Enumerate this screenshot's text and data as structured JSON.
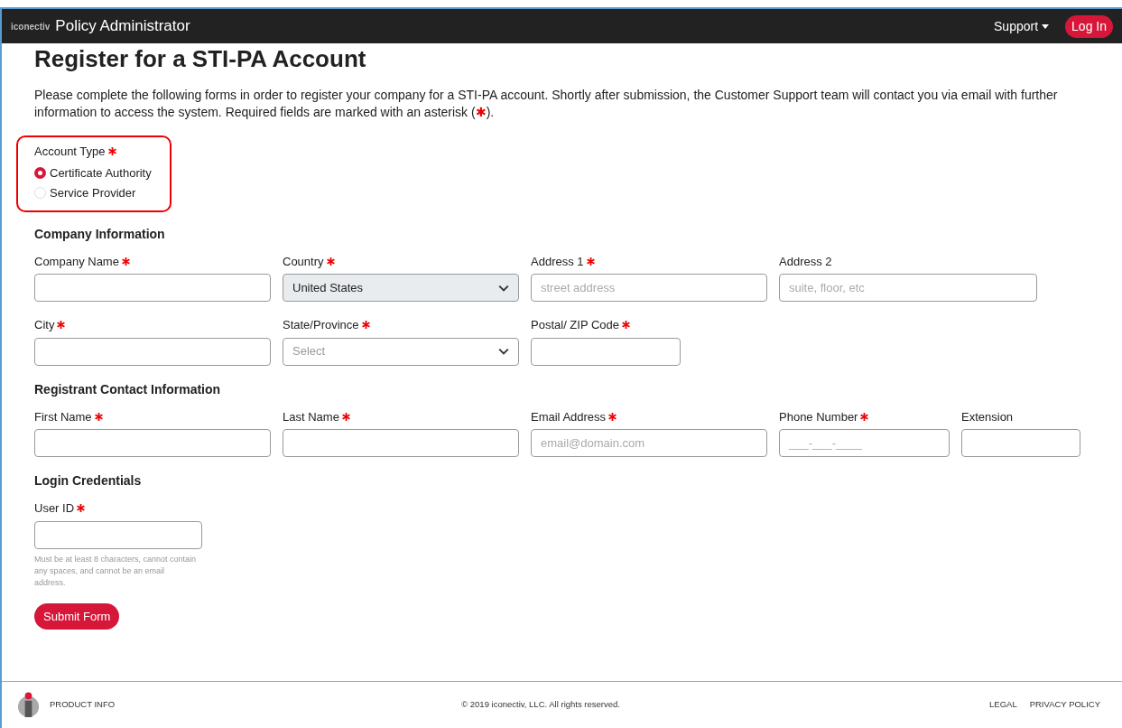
{
  "navbar": {
    "brand": "iconectiv",
    "title": "Policy Administrator",
    "support": "Support",
    "login": "Log In"
  },
  "page_title": "Register for a STI-PA Account",
  "intro": {
    "text": "Please complete the following forms in order to register your company for a STI-PA account. Shortly after submission, the Customer Support team will contact you via email with further information to access the system. Required fields are marked with an asterisk (",
    "mark": "✱",
    "end": ")."
  },
  "account_type": {
    "label": "Account Type",
    "required": true,
    "highlighted": true,
    "options": [
      {
        "label": "Certificate Authority",
        "selected": true
      },
      {
        "label": "Service Provider",
        "selected": false
      }
    ]
  },
  "sections": [
    {
      "title": "Company Information",
      "rows": [
        [
          {
            "kind": "input",
            "label": "Company Name",
            "required": true
          },
          {
            "kind": "select",
            "label": "Country",
            "required": true,
            "value": "United States"
          },
          {
            "kind": "input",
            "label": "Address 1",
            "required": true,
            "placeholder": "street address"
          },
          {
            "kind": "input",
            "label": "Address 2",
            "required": false,
            "placeholder": "suite, floor, etc"
          }
        ],
        [
          {
            "kind": "input",
            "label": "City",
            "required": true
          },
          {
            "kind": "select",
            "label": "State/Province",
            "required": true,
            "placeholder": "Select"
          },
          {
            "kind": "input",
            "label": "Postal/ ZIP Code",
            "required": true
          }
        ]
      ]
    },
    {
      "title": "Registrant Contact Information",
      "rows": [
        [
          {
            "kind": "input",
            "label": "First Name",
            "required": true
          },
          {
            "kind": "input",
            "label": "Last Name",
            "required": true
          },
          {
            "kind": "input",
            "label": "Email Address",
            "required": true,
            "placeholder": "email@domain.com"
          },
          {
            "kind": "input",
            "label": "Phone Number",
            "required": true,
            "placeholder": "___-___-____"
          },
          {
            "kind": "input",
            "label": "Extension",
            "required": false
          }
        ]
      ]
    },
    {
      "title": "Login Credentials",
      "rows": [
        [
          {
            "kind": "input",
            "label": "User ID",
            "required": true,
            "help": "Must be at least 8 characters, cannot contain any spaces, and cannot be an email address."
          }
        ]
      ]
    }
  ],
  "submit": "Submit Form",
  "footer": {
    "product_info": "PRODUCT INFO",
    "copyright": "© 2019 iconectiv, LLC. All rights reserved.",
    "links": [
      "LEGAL",
      "PRIVACY POLICY"
    ]
  }
}
